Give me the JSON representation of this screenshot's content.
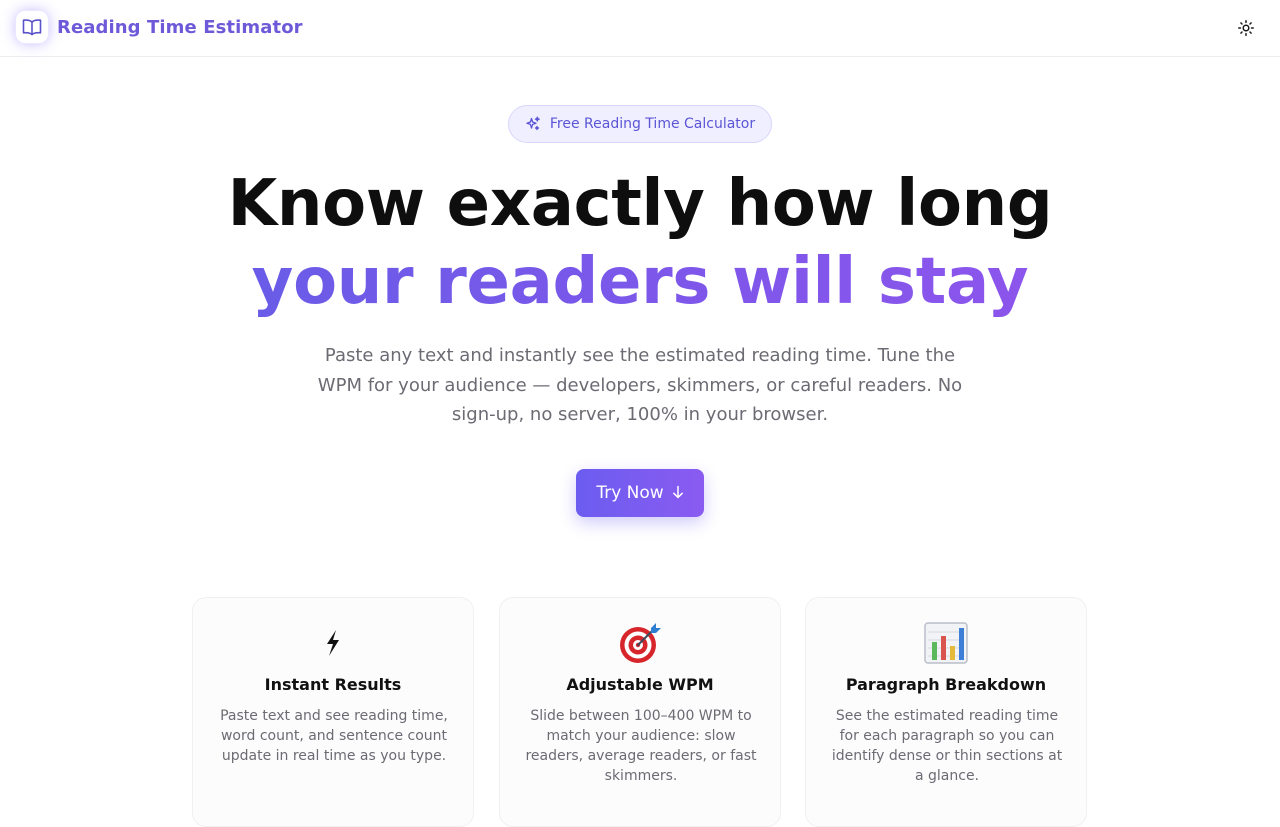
{
  "header": {
    "app_title": "Reading Time Estimator",
    "logo_icon": "open-book-icon",
    "theme_toggle_icon": "sun-icon"
  },
  "hero": {
    "badge_icon": "sparkles-icon",
    "badge_text": "Free Reading Time Calculator",
    "headline_line1": "Know exactly how long",
    "headline_line2": "your readers will stay",
    "subtext": "Paste any text and instantly see the estimated reading time. Tune the WPM for your audience — developers, skimmers, or careful readers. No sign-up, no server, 100% in your browser.",
    "cta_label": "Try Now",
    "cta_icon": "arrow-down-icon"
  },
  "features": [
    {
      "icon": "lightning-icon",
      "title": "Instant Results",
      "description": "Paste text and see reading time, word count, and sentence count update in real time as you type."
    },
    {
      "icon": "target-icon",
      "title": "Adjustable WPM",
      "description": "Slide between 100–400 WPM to match your audience: slow readers, average readers, or fast skimmers."
    },
    {
      "icon": "bar-chart-icon",
      "title": "Paragraph Breakdown",
      "description": "See the estimated reading time for each paragraph so you can identify dense or thin sections at a glance."
    }
  ],
  "colors": {
    "brand": "#6e5ad8",
    "accent_start": "#6c5cf0",
    "accent_end": "#8a5bf1",
    "badge_bg": "#f0efff",
    "muted_text": "#6b6b73"
  }
}
